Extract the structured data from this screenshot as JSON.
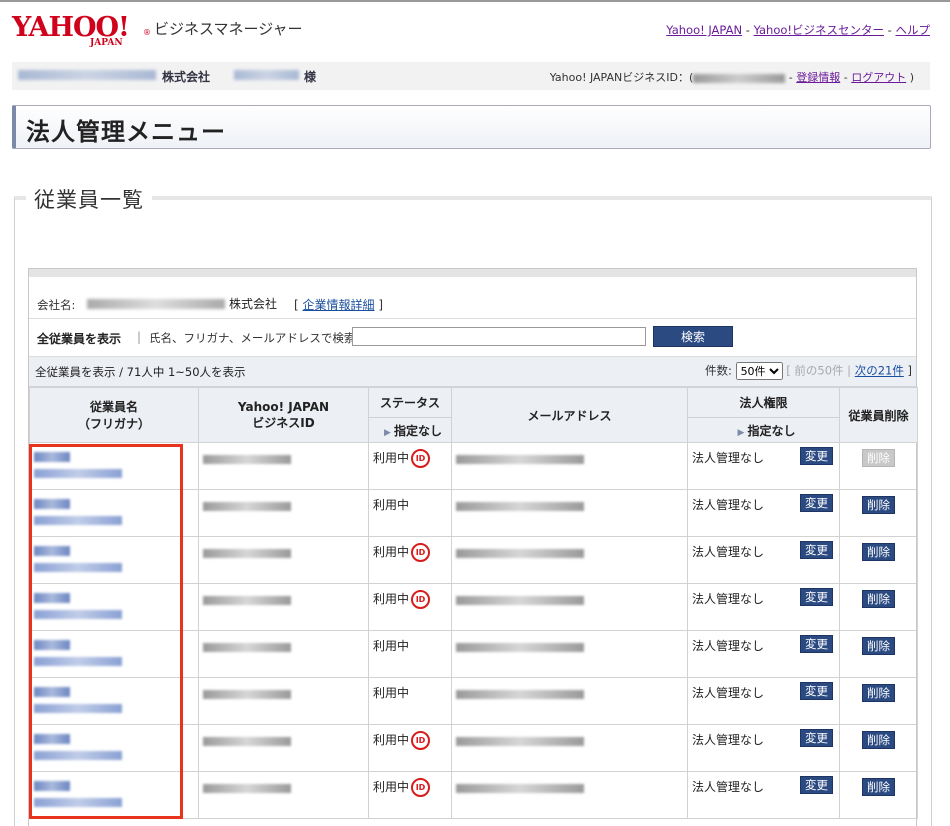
{
  "header": {
    "logo_text": "YAHOO!",
    "logo_sub": "JAPAN",
    "logo_reg": "®",
    "app_name": "ビジネスマネージャー",
    "links": [
      "Yahoo! JAPAN",
      "Yahoo!ビジネスセンター",
      "ヘルプ"
    ],
    "link_sep": " - "
  },
  "userbar": {
    "company_suffix": "株式会社",
    "honorific": "様",
    "bizid_label": "Yahoo! JAPANビジネスID：(",
    "bizid_tail": " - ",
    "links": [
      "登録情報",
      "ログアウト"
    ],
    "close_paren": " )"
  },
  "menu_title": "法人管理メニュー",
  "section_title": "従業員一覧",
  "company": {
    "label": "会社名:",
    "suffix": "株式会社",
    "detail_link": "企業情報詳細",
    "open_bracket": "[ ",
    "close_bracket": " ]"
  },
  "search": {
    "all_label": "全従業員を表示",
    "sep": "|",
    "label": "氏名、フリガナ、メールアドレスで検索",
    "value": "",
    "button": "検索"
  },
  "list_info": {
    "text": "全従業員を表示 / 71人中 1~50人を表示",
    "count_label": "件数:",
    "count_value": "50件",
    "prev": "前の50件",
    "next": "次の21件"
  },
  "table": {
    "headers": {
      "name": "従業員名",
      "name_kana": "（フリガナ）",
      "bizid_1": "Yahoo! JAPAN",
      "bizid_2": "ビジネスID",
      "status": "ステータス",
      "status_filter": "指定なし",
      "email": "メールアドレス",
      "perm": "法人権限",
      "perm_filter": "指定なし",
      "delete": "従業員削除"
    },
    "rows": [
      {
        "status": "利用中",
        "id_icon": true,
        "perm": "法人管理なし",
        "change": "変更",
        "delete": "削除",
        "delete_enabled": false
      },
      {
        "status": "利用中",
        "id_icon": false,
        "perm": "法人管理なし",
        "change": "変更",
        "delete": "削除",
        "delete_enabled": true
      },
      {
        "status": "利用中",
        "id_icon": true,
        "perm": "法人管理なし",
        "change": "変更",
        "delete": "削除",
        "delete_enabled": true
      },
      {
        "status": "利用中",
        "id_icon": true,
        "perm": "法人管理なし",
        "change": "変更",
        "delete": "削除",
        "delete_enabled": true
      },
      {
        "status": "利用中",
        "id_icon": false,
        "perm": "法人管理なし",
        "change": "変更",
        "delete": "削除",
        "delete_enabled": true
      },
      {
        "status": "利用中",
        "id_icon": false,
        "perm": "法人管理なし",
        "change": "変更",
        "delete": "削除",
        "delete_enabled": true
      },
      {
        "status": "利用中",
        "id_icon": true,
        "perm": "法人管理なし",
        "change": "変更",
        "delete": "削除",
        "delete_enabled": true
      },
      {
        "status": "利用中",
        "id_icon": true,
        "perm": "法人管理なし",
        "change": "変更",
        "delete": "削除",
        "delete_enabled": true
      }
    ]
  },
  "id_icon_text": "ID",
  "colors": {
    "brand_red": "#d0021b",
    "button_blue": "#2b4a82",
    "highlight": "#e8341c"
  }
}
